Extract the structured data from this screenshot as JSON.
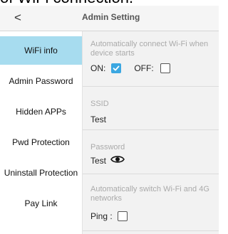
{
  "page_top_cutoff": "of WiFi connection.",
  "header": {
    "back_icon": "chevron-left-icon",
    "back_glyph": "<",
    "title": "Admin Setting"
  },
  "sidebar": {
    "active_color": "#a7dcef",
    "items": [
      {
        "label": "WiFi info",
        "active": true
      },
      {
        "label": "Admin Password",
        "active": false
      },
      {
        "label": "Hidden APPs",
        "active": false
      },
      {
        "label": "Pwd Protection",
        "active": false
      },
      {
        "label": "Uninstall Protection",
        "active": false
      },
      {
        "label": "Pay Link",
        "active": false
      }
    ]
  },
  "main": {
    "auto_connect": {
      "description": "Automatically connect Wi-Fi when device starts",
      "on_label": "ON:",
      "on_checked": true,
      "off_label": "OFF:",
      "off_checked": false,
      "check_color": "#3ba7e1"
    },
    "ssid": {
      "label": "SSID",
      "value": "Test"
    },
    "password": {
      "label": "Password",
      "value": "Test",
      "icon": "eye-icon"
    },
    "auto_switch": {
      "description": "Automatically switch Wi-Fi and 4G networks",
      "ping_label": "Ping :",
      "ping_checked": false
    }
  }
}
